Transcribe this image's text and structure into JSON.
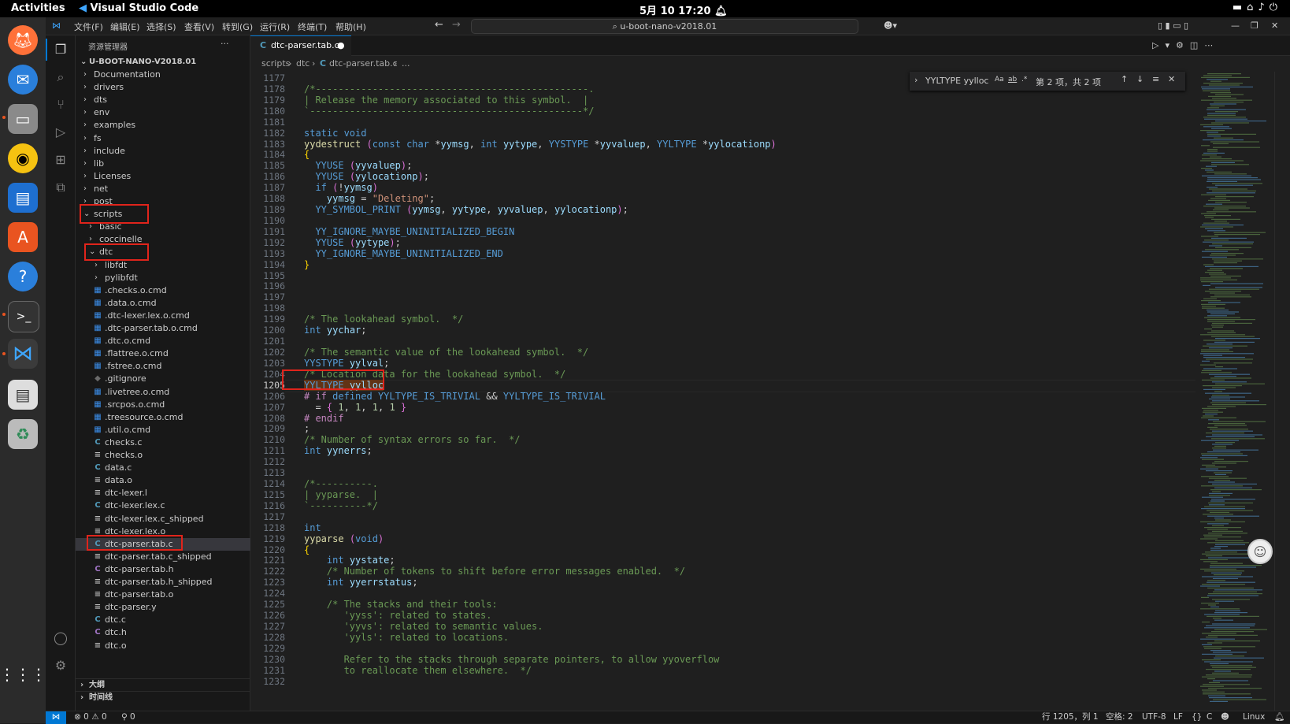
{
  "system": {
    "activities": "Activities",
    "app_name": "Visual Studio Code",
    "clock": "5月 10  17:20"
  },
  "menu": [
    "文件(F)",
    "编辑(E)",
    "选择(S)",
    "查看(V)",
    "转到(G)",
    "运行(R)",
    "终端(T)",
    "帮助(H)"
  ],
  "title_search": "u-boot-nano-v2018.01",
  "sidebar": {
    "header": "资源管理器",
    "more": "···",
    "root": "U-BOOT-NANO-V2018.01",
    "items": [
      {
        "label": "Documentation",
        "kind": "folder",
        "depth": 1,
        "open": false
      },
      {
        "label": "drivers",
        "kind": "folder",
        "depth": 1,
        "open": false
      },
      {
        "label": "dts",
        "kind": "folder",
        "depth": 1,
        "open": false
      },
      {
        "label": "env",
        "kind": "folder",
        "depth": 1,
        "open": false
      },
      {
        "label": "examples",
        "kind": "folder",
        "depth": 1,
        "open": false
      },
      {
        "label": "fs",
        "kind": "folder",
        "depth": 1,
        "open": false
      },
      {
        "label": "include",
        "kind": "folder",
        "depth": 1,
        "open": false
      },
      {
        "label": "lib",
        "kind": "folder",
        "depth": 1,
        "open": false
      },
      {
        "label": "Licenses",
        "kind": "folder",
        "depth": 1,
        "open": false
      },
      {
        "label": "net",
        "kind": "folder",
        "depth": 1,
        "open": false
      },
      {
        "label": "post",
        "kind": "folder",
        "depth": 1,
        "open": false
      },
      {
        "label": "scripts",
        "kind": "folder",
        "depth": 1,
        "open": true
      },
      {
        "label": "basic",
        "kind": "folder",
        "depth": 2,
        "open": false
      },
      {
        "label": "coccinelle",
        "kind": "folder",
        "depth": 2,
        "open": false
      },
      {
        "label": "dtc",
        "kind": "folder",
        "depth": 2,
        "open": true
      },
      {
        "label": "libfdt",
        "kind": "folder",
        "depth": 3,
        "open": false
      },
      {
        "label": "pylibfdt",
        "kind": "folder",
        "depth": 3,
        "open": false
      },
      {
        "label": ".checks.o.cmd",
        "kind": "cmd",
        "depth": 3
      },
      {
        "label": ".data.o.cmd",
        "kind": "cmd",
        "depth": 3
      },
      {
        "label": ".dtc-lexer.lex.o.cmd",
        "kind": "cmd",
        "depth": 3
      },
      {
        "label": ".dtc-parser.tab.o.cmd",
        "kind": "cmd",
        "depth": 3
      },
      {
        "label": ".dtc.o.cmd",
        "kind": "cmd",
        "depth": 3
      },
      {
        "label": ".flattree.o.cmd",
        "kind": "cmd",
        "depth": 3
      },
      {
        "label": ".fstree.o.cmd",
        "kind": "cmd",
        "depth": 3
      },
      {
        "label": ".gitignore",
        "kind": "git",
        "depth": 3
      },
      {
        "label": ".livetree.o.cmd",
        "kind": "cmd",
        "depth": 3
      },
      {
        "label": ".srcpos.o.cmd",
        "kind": "cmd",
        "depth": 3
      },
      {
        "label": ".treesource.o.cmd",
        "kind": "cmd",
        "depth": 3
      },
      {
        "label": ".util.o.cmd",
        "kind": "cmd",
        "depth": 3
      },
      {
        "label": "checks.c",
        "kind": "c",
        "depth": 3
      },
      {
        "label": "checks.o",
        "kind": "txt",
        "depth": 3
      },
      {
        "label": "data.c",
        "kind": "c",
        "depth": 3
      },
      {
        "label": "data.o",
        "kind": "txt",
        "depth": 3
      },
      {
        "label": "dtc-lexer.l",
        "kind": "txt",
        "depth": 3
      },
      {
        "label": "dtc-lexer.lex.c",
        "kind": "c",
        "depth": 3
      },
      {
        "label": "dtc-lexer.lex.c_shipped",
        "kind": "txt",
        "depth": 3
      },
      {
        "label": "dtc-lexer.lex.o",
        "kind": "txt",
        "depth": 3
      },
      {
        "label": "dtc-parser.tab.c",
        "kind": "c",
        "depth": 3,
        "selected": true
      },
      {
        "label": "dtc-parser.tab.c_shipped",
        "kind": "txt",
        "depth": 3
      },
      {
        "label": "dtc-parser.tab.h",
        "kind": "h",
        "depth": 3
      },
      {
        "label": "dtc-parser.tab.h_shipped",
        "kind": "txt",
        "depth": 3
      },
      {
        "label": "dtc-parser.tab.o",
        "kind": "txt",
        "depth": 3
      },
      {
        "label": "dtc-parser.y",
        "kind": "txt",
        "depth": 3
      },
      {
        "label": "dtc.c",
        "kind": "c",
        "depth": 3
      },
      {
        "label": "dtc.h",
        "kind": "h",
        "depth": 3
      },
      {
        "label": "dtc.o",
        "kind": "txt",
        "depth": 3
      }
    ],
    "outline": "大纲",
    "timeline": "时间线"
  },
  "tab": {
    "label": "dtc-parser.tab.c",
    "modified": true
  },
  "breadcrumb": [
    "scripts",
    "dtc",
    "dtc-parser.tab.c",
    "..."
  ],
  "find": {
    "query": "YYLTYPE yylloc",
    "opt_case": "Aa",
    "opt_word": "ab",
    "opt_regex": ".*",
    "result": "第 2 项，共 2 项"
  },
  "editor": {
    "current_line": "1205",
    "lines": [
      {
        "n": "1177",
        "t": ""
      },
      {
        "n": "1178",
        "t": "/*------------------------------------------------.",
        "c": "com"
      },
      {
        "n": "1179",
        "t": "| Release the memory associated to this symbol.  |",
        "c": "com"
      },
      {
        "n": "1180",
        "t": "`------------------------------------------------*/",
        "c": "com"
      },
      {
        "n": "1181",
        "t": ""
      },
      {
        "n": "1182",
        "t": "static void",
        "c": "kw"
      },
      {
        "n": "1183",
        "t": "yydestruct (const char *yymsg, int yytype, YYSTYPE *yyvaluep, YYLTYPE *yylocationp)",
        "c": "mix"
      },
      {
        "n": "1184",
        "t": "{",
        "c": "br"
      },
      {
        "n": "1185",
        "t": "  YYUSE (yyvaluep);",
        "c": "mix"
      },
      {
        "n": "1186",
        "t": "  YYUSE (yylocationp);",
        "c": "mix"
      },
      {
        "n": "1187",
        "t": "  if (!yymsg)",
        "c": "mix"
      },
      {
        "n": "1188",
        "t": "    yymsg = \"Deleting\";",
        "c": "mix"
      },
      {
        "n": "1189",
        "t": "  YY_SYMBOL_PRINT (yymsg, yytype, yyvaluep, yylocationp);",
        "c": "mix"
      },
      {
        "n": "1190",
        "t": ""
      },
      {
        "n": "1191",
        "t": "  YY_IGNORE_MAYBE_UNINITIALIZED_BEGIN",
        "c": "kw"
      },
      {
        "n": "1192",
        "t": "  YYUSE (yytype);",
        "c": "mix"
      },
      {
        "n": "1193",
        "t": "  YY_IGNORE_MAYBE_UNINITIALIZED_END",
        "c": "kw"
      },
      {
        "n": "1194",
        "t": "}",
        "c": "br"
      },
      {
        "n": "1195",
        "t": ""
      },
      {
        "n": "1196",
        "t": ""
      },
      {
        "n": "1197",
        "t": ""
      },
      {
        "n": "1198",
        "t": ""
      },
      {
        "n": "1199",
        "t": "/* The lookahead symbol.  */",
        "c": "com"
      },
      {
        "n": "1200",
        "t": "int yychar;",
        "c": "mix"
      },
      {
        "n": "1201",
        "t": ""
      },
      {
        "n": "1202",
        "t": "/* The semantic value of the lookahead symbol.  */",
        "c": "com"
      },
      {
        "n": "1203",
        "t": "YYSTYPE yylval;",
        "c": "mix"
      },
      {
        "n": "1204",
        "t": "/* Location data for the lookahead symbol.  */",
        "c": "com"
      },
      {
        "n": "1205",
        "t": "YYLTYPE yylloc",
        "c": "mix"
      },
      {
        "n": "1206",
        "t": "# if defined YYLTYPE_IS_TRIVIAL && YYLTYPE_IS_TRIVIAL",
        "c": "pp"
      },
      {
        "n": "1207",
        "t": "  = { 1, 1, 1, 1 }",
        "c": "num"
      },
      {
        "n": "1208",
        "t": "# endif",
        "c": "pp"
      },
      {
        "n": "1209",
        "t": ";"
      },
      {
        "n": "1210",
        "t": "/* Number of syntax errors so far.  */",
        "c": "com"
      },
      {
        "n": "1211",
        "t": "int yynerrs;",
        "c": "mix"
      },
      {
        "n": "1212",
        "t": ""
      },
      {
        "n": "1213",
        "t": ""
      },
      {
        "n": "1214",
        "t": "/*----------.",
        "c": "com"
      },
      {
        "n": "1215",
        "t": "| yyparse.  |",
        "c": "com"
      },
      {
        "n": "1216",
        "t": "`----------*/",
        "c": "com"
      },
      {
        "n": "1217",
        "t": ""
      },
      {
        "n": "1218",
        "t": "int",
        "c": "kw"
      },
      {
        "n": "1219",
        "t": "yyparse (void)",
        "c": "mix"
      },
      {
        "n": "1220",
        "t": "{",
        "c": "br"
      },
      {
        "n": "1221",
        "t": "    int yystate;",
        "c": "mix"
      },
      {
        "n": "1222",
        "t": "    /* Number of tokens to shift before error messages enabled.  */",
        "c": "com"
      },
      {
        "n": "1223",
        "t": "    int yyerrstatus;",
        "c": "mix"
      },
      {
        "n": "1224",
        "t": ""
      },
      {
        "n": "1225",
        "t": "    /* The stacks and their tools:",
        "c": "com"
      },
      {
        "n": "1226",
        "t": "       'yyss': related to states.",
        "c": "com"
      },
      {
        "n": "1227",
        "t": "       'yyvs': related to semantic values.",
        "c": "com"
      },
      {
        "n": "1228",
        "t": "       'yyls': related to locations.",
        "c": "com"
      },
      {
        "n": "1229",
        "t": ""
      },
      {
        "n": "1230",
        "t": "       Refer to the stacks through separate pointers, to allow yyoverflow",
        "c": "com"
      },
      {
        "n": "1231",
        "t": "       to reallocate them elsewhere.  */",
        "c": "com"
      },
      {
        "n": "1232",
        "t": ""
      }
    ]
  },
  "status": {
    "errors": "0",
    "warnings": "0",
    "ports": "0",
    "position": "行 1205，列 1",
    "spaces": "空格: 2",
    "encoding": "UTF-8",
    "eol": "LF",
    "language": "C",
    "platform": "Linux"
  },
  "colors": {
    "highlight_box": "#e0241b",
    "accent": "#0078d4",
    "find_match": "#623315"
  }
}
